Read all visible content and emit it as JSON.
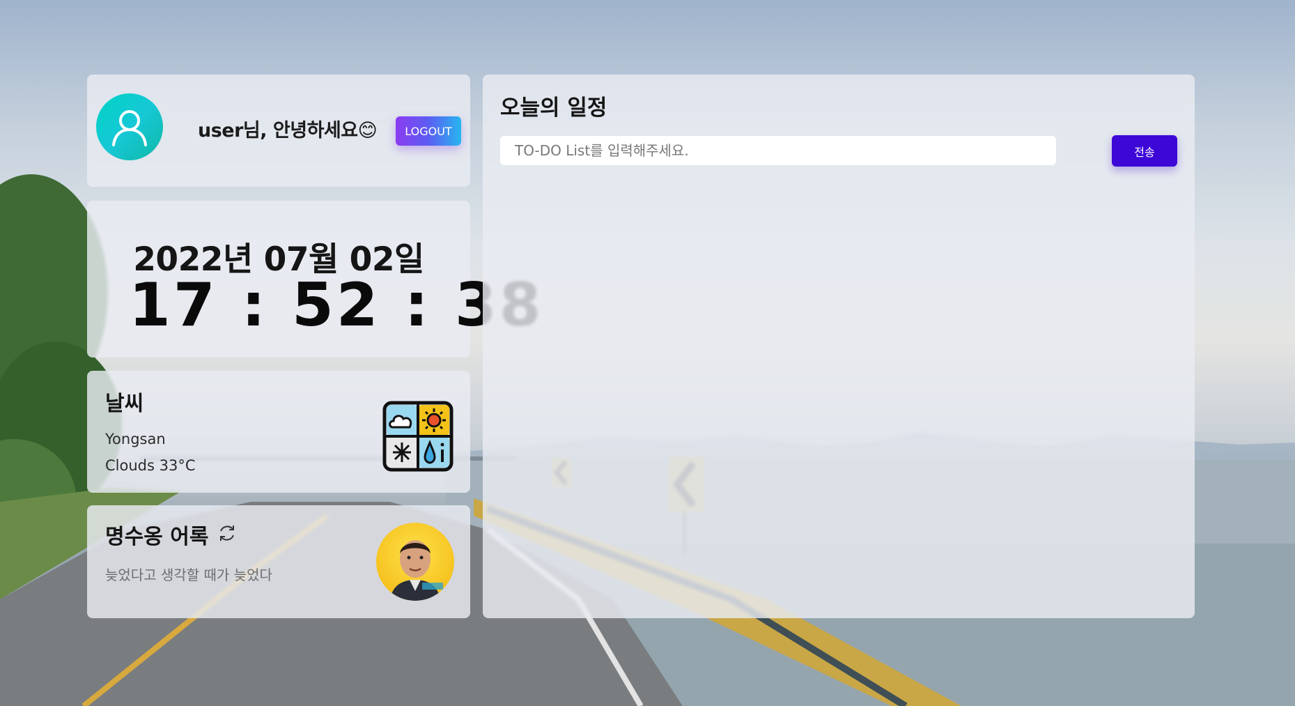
{
  "profile": {
    "greeting": "user님, 안녕하세요😊",
    "logout_label": "LOGOUT"
  },
  "clock": {
    "date": "2022년 07월 02일",
    "time": "17 : 52 : 38"
  },
  "weather": {
    "title": "날씨",
    "location": "Yongsan",
    "description": "Clouds 33°C"
  },
  "quote": {
    "title": "명수옹 어록",
    "text": "늦었다고 생각할 때가 늦었다"
  },
  "todo": {
    "title": "오늘의 일정",
    "input_placeholder": "TO-DO List를 입력해주세요.",
    "input_value": "",
    "submit_label": "전송"
  },
  "colors": {
    "logout_gradient": [
      "#8a3cf0",
      "#27b6f0"
    ],
    "submit": "#3d07d8",
    "avatar_gradient": [
      "#00d3c4",
      "#0fb8a6"
    ]
  }
}
